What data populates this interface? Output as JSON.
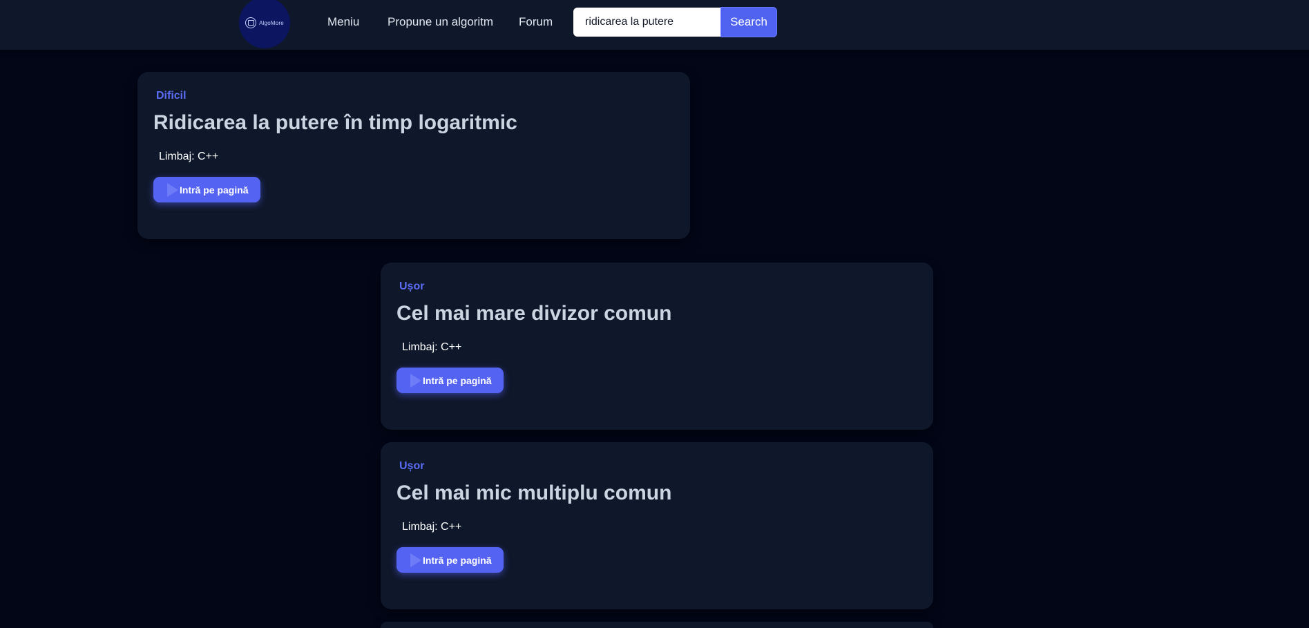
{
  "header": {
    "logo_text": "AlgoMore",
    "nav": [
      "Meniu",
      "Propune un algoritm",
      "Forum"
    ],
    "search": {
      "value": "ridicarea la putere",
      "button_label": "Search"
    }
  },
  "cards": [
    {
      "difficulty": "Dificil",
      "title": "Ridicarea la putere în timp logaritmic",
      "language": "Limbaj: C++",
      "button_label": "Intră pe pagină"
    },
    {
      "difficulty": "Ușor",
      "title": "Cel mai mare divizor comun",
      "language": "Limbaj: C++",
      "button_label": "Intră pe pagină"
    },
    {
      "difficulty": "Ușor",
      "title": "Cel mai mic multiplu comun",
      "language": "Limbaj: C++",
      "button_label": "Intră pe pagină"
    }
  ],
  "colors": {
    "background": "#020617",
    "card": "#0f172a",
    "accent": "#5563f2",
    "difficulty": "#5b6cf5"
  }
}
